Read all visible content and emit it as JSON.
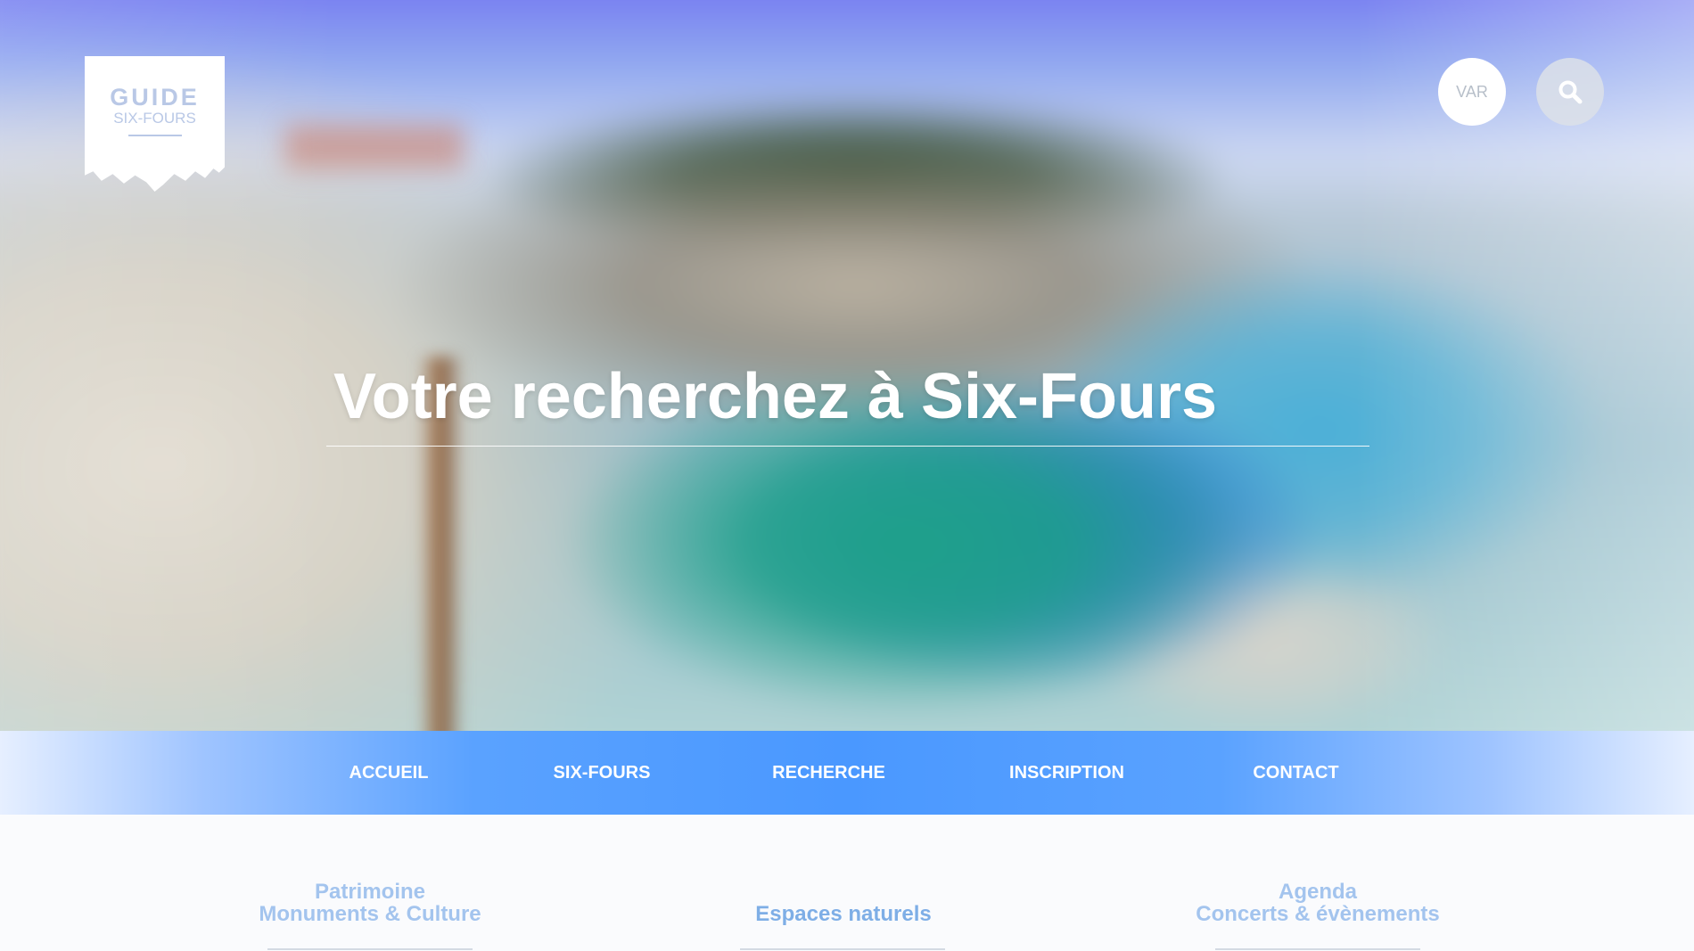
{
  "logo": {
    "line1": "GUIDE",
    "line2": "SIX-FOURS"
  },
  "header": {
    "region_button": "VAR",
    "search_icon": "search-icon"
  },
  "hero": {
    "title": "Votre recherchez à Six-Fours"
  },
  "nav": {
    "items": [
      {
        "label": "ACCUEIL"
      },
      {
        "label": "SIX-FOURS"
      },
      {
        "label": "RECHERCHE"
      },
      {
        "label": "INSCRIPTION"
      },
      {
        "label": "CONTACT"
      }
    ]
  },
  "categories": [
    {
      "line1": "Patrimoine",
      "line2": "Monuments & Culture"
    },
    {
      "line1": "",
      "line2": "Espaces naturels"
    },
    {
      "line1": "Agenda",
      "line2": "Concerts & évènements"
    }
  ],
  "colors": {
    "nav_accent": "#4a98ff",
    "category_text": "#7eaee6",
    "logo_text": "#b9c8e6"
  }
}
